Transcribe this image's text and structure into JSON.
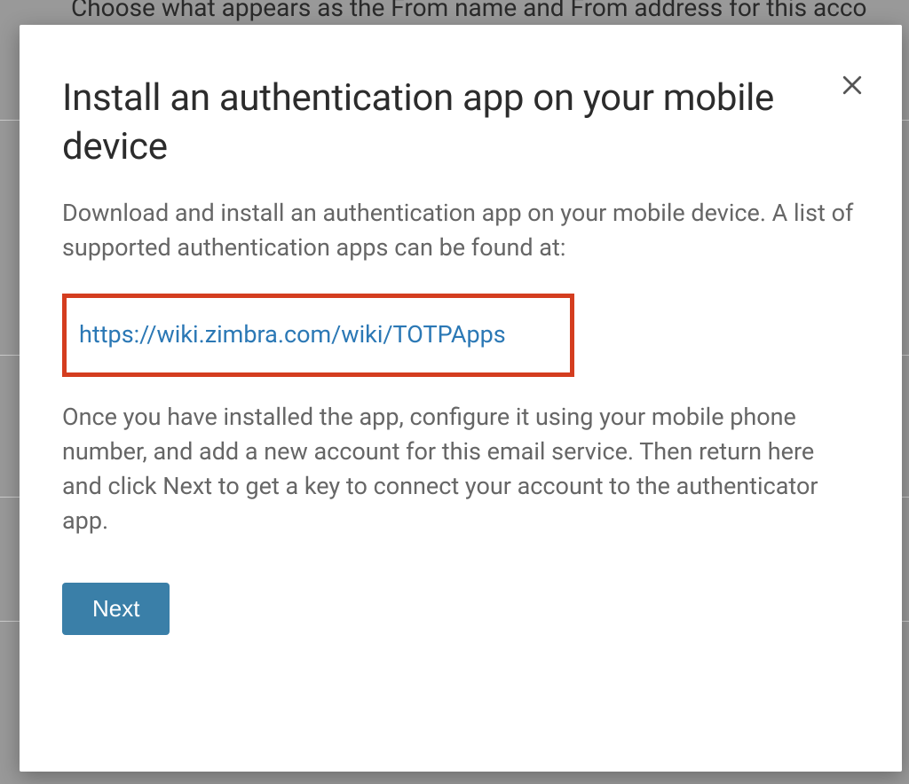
{
  "backdrop": {
    "hint_text": "Choose what appears as the From name and From address for this acco"
  },
  "modal": {
    "title": "Install an authentication app on your mobile device",
    "paragraph1": "Download and install an authentication app on your mobile device. A list of supported authentication apps can be found at:",
    "link_url": "https://wiki.zimbra.com/wiki/TOTPApps",
    "paragraph2": "Once you have installed the app, configure it using your mobile phone number, and add a new account for this email service. Then return here and click Next to get a key to connect your account to the authenticator app.",
    "next_button": "Next"
  },
  "colors": {
    "highlight_border": "#d43d1f",
    "link": "#2b78b5",
    "primary_btn": "#3a7fa8"
  }
}
